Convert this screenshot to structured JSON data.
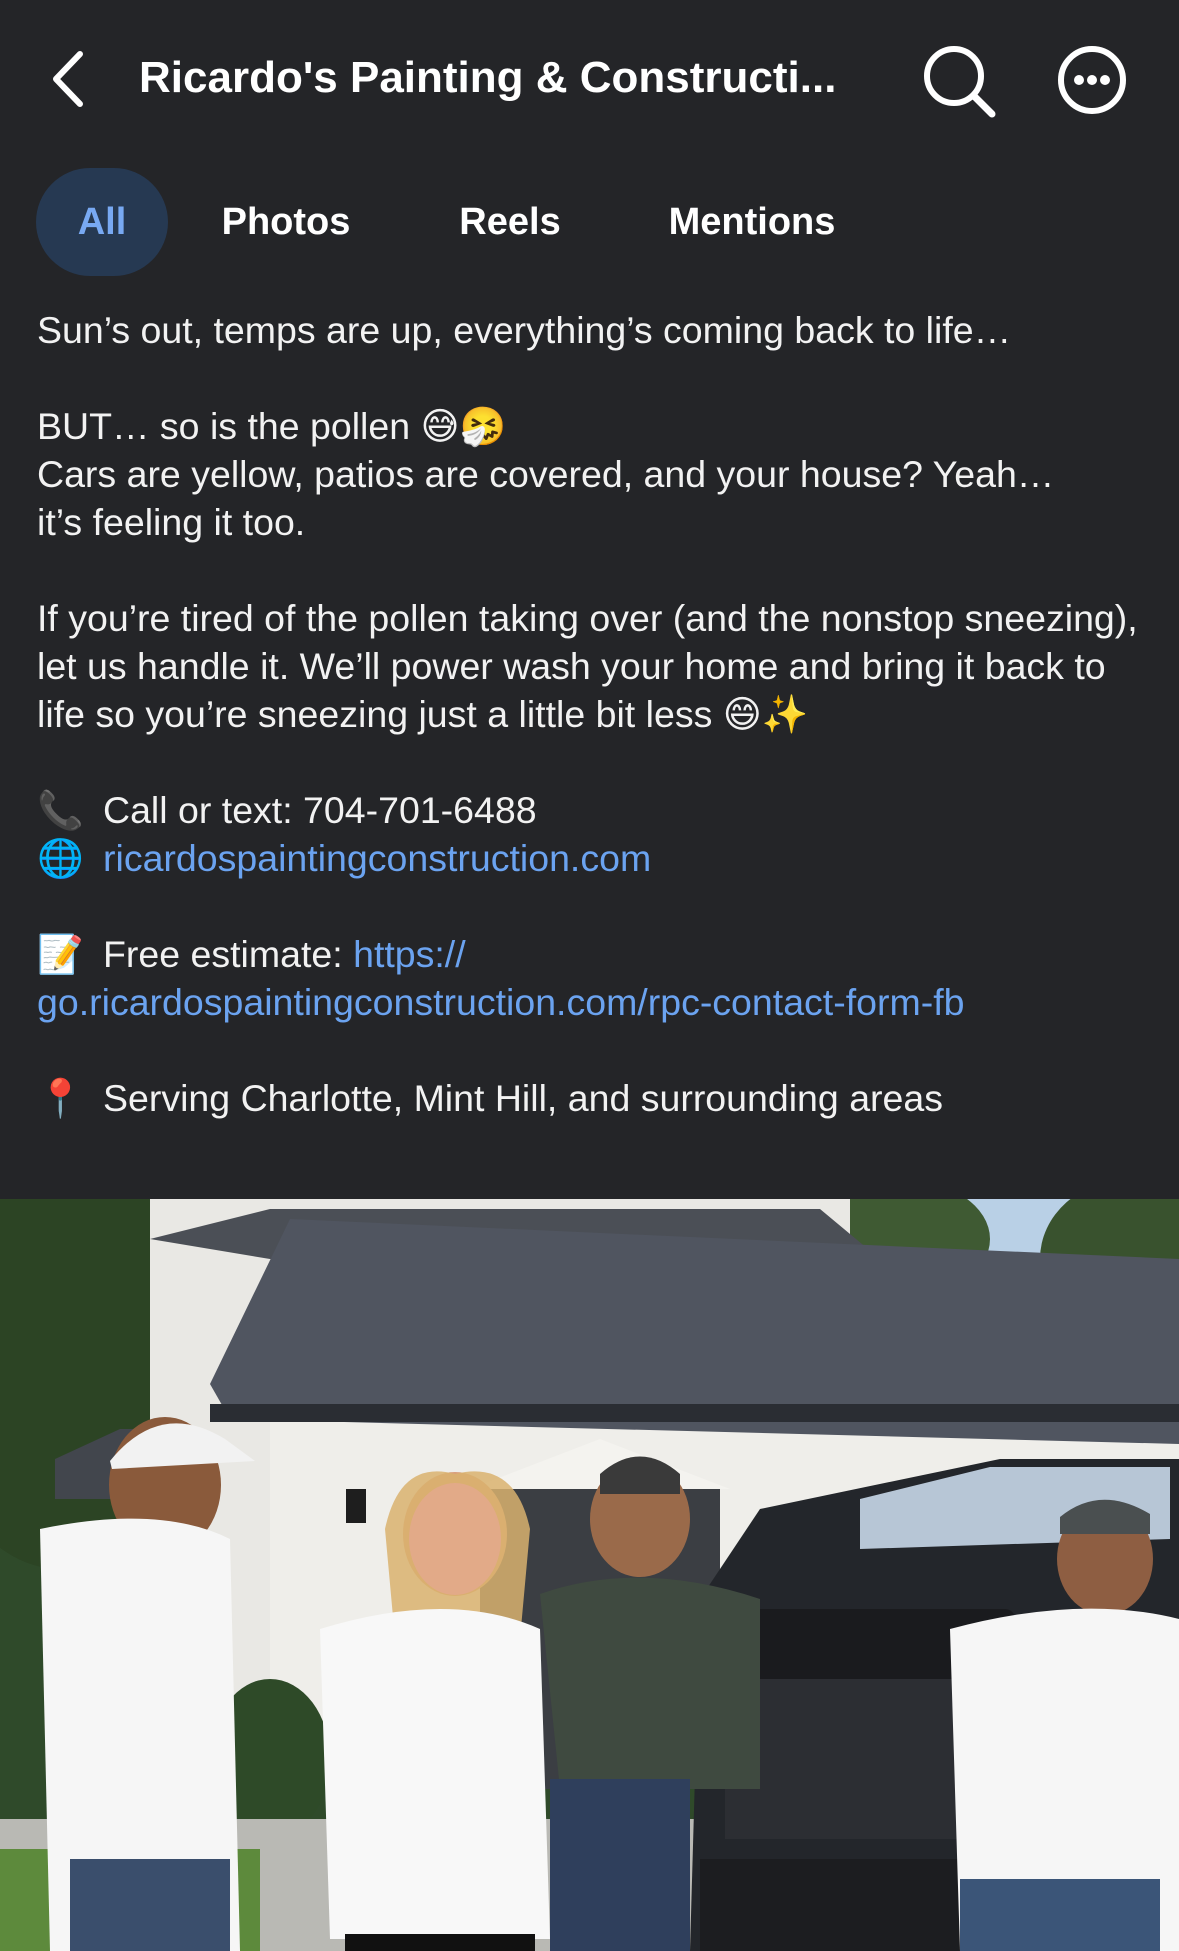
{
  "header": {
    "title": "Ricardo's Painting & Constructi...",
    "back_icon": "chevron-left-icon",
    "search_icon": "search-icon",
    "more_icon": "more-horizontal-icon"
  },
  "tabs": [
    {
      "label": "All",
      "active": true
    },
    {
      "label": "Photos",
      "active": false
    },
    {
      "label": "Reels",
      "active": false
    },
    {
      "label": "Mentions",
      "active": false
    }
  ],
  "post": {
    "line1": "Sun’s out, temps are up, everything’s coming back to life…",
    "line2_text": "BUT… so is the pollen ",
    "line2_emoji": "😅🤧",
    "line3": "Cars are yellow, patios are covered, and your house? Yeah…",
    "line4": "it’s feeling it too.",
    "para3": "If you’re tired of the pollen taking over (and the nonstop sneezing), let us handle it. We’ll power wash your home and bring it back to life so you’re sneezing just a little bit less ",
    "para3_emoji": "😄✨",
    "phone_emoji": "📞",
    "phone_text": "Call or text: 704-701-6488",
    "web_emoji": "🌐",
    "website": "ricardospaintingconstruction.com",
    "estimate_emoji": "📝",
    "estimate_label": "Free estimate: ",
    "estimate_link_1": "https://",
    "estimate_link_2": "go.ricardospaintingconstruction.com/rpc-contact-form-fb",
    "pin_emoji": "📍",
    "serving": "Serving Charlotte, Mint Hill, and surrounding areas"
  },
  "colors": {
    "background": "#242528",
    "text": "#f2f2f2",
    "link": "#6ba3f0",
    "active_tab_bg": "#263952",
    "active_tab_text": "#78a9f2"
  }
}
